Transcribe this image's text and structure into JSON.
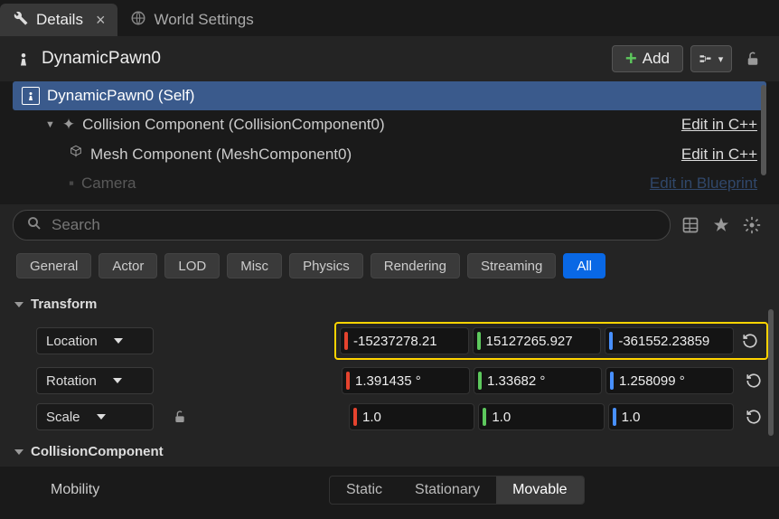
{
  "tabs": [
    {
      "label": "Details",
      "active": true,
      "closable": true
    },
    {
      "label": "World Settings",
      "active": false,
      "closable": false
    }
  ],
  "titleBar": {
    "actorName": "DynamicPawn0",
    "addLabel": "Add"
  },
  "tree": {
    "items": [
      {
        "label": "DynamicPawn0 (Self)",
        "depth": 0,
        "selected": true,
        "editLink": null
      },
      {
        "label": "Collision Component (CollisionComponent0)",
        "depth": 1,
        "selected": false,
        "editLink": "Edit in C++"
      },
      {
        "label": "Mesh Component (MeshComponent0)",
        "depth": 2,
        "selected": false,
        "editLink": "Edit in C++"
      },
      {
        "label": "Camera",
        "depth": 2,
        "selected": false,
        "editLink": "Edit in Blueprint",
        "blue": true
      }
    ]
  },
  "search": {
    "placeholder": "Search"
  },
  "filters": [
    "General",
    "Actor",
    "LOD",
    "Misc",
    "Physics",
    "Rendering",
    "Streaming",
    "All"
  ],
  "filterActive": "All",
  "sections": {
    "transform": {
      "title": "Transform",
      "location": {
        "label": "Location",
        "x": "-15237278.21",
        "y": "15127265.927",
        "z": "-361552.23859"
      },
      "rotation": {
        "label": "Rotation",
        "x": "1.391435 °",
        "y": "1.33682 °",
        "z": "1.258099 °"
      },
      "scale": {
        "label": "Scale",
        "x": "1.0",
        "y": "1.0",
        "z": "1.0"
      }
    },
    "collision": {
      "title": "CollisionComponent",
      "mobility": {
        "label": "Mobility",
        "options": [
          "Static",
          "Stationary",
          "Movable"
        ],
        "active": "Movable"
      }
    }
  }
}
